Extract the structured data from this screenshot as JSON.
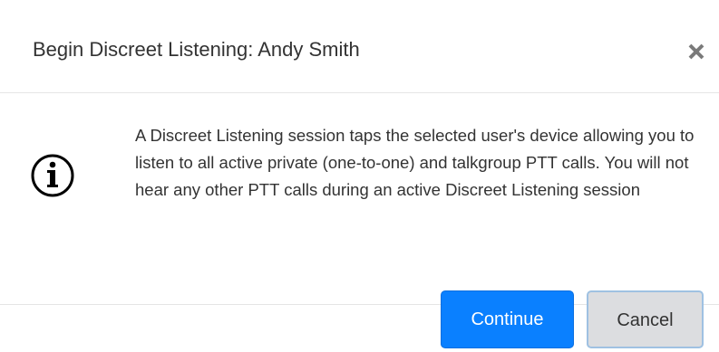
{
  "dialog": {
    "title": "Begin Discreet Listening: Andy Smith",
    "close_icon": "close-icon",
    "info_icon": "info-circle-icon",
    "message": "A Discreet Listening session taps the selected user's device allowing you to listen to all active private (one-to-one) and talkgroup PTT calls. You will not hear any other PTT calls during an active Discreet Listening session",
    "buttons": {
      "continue_label": "Continue",
      "cancel_label": "Cancel"
    }
  },
  "colors": {
    "primary_button": "#0a80ff",
    "secondary_button": "#dcdde0",
    "text": "#333333",
    "divider": "#e5e5e5"
  }
}
